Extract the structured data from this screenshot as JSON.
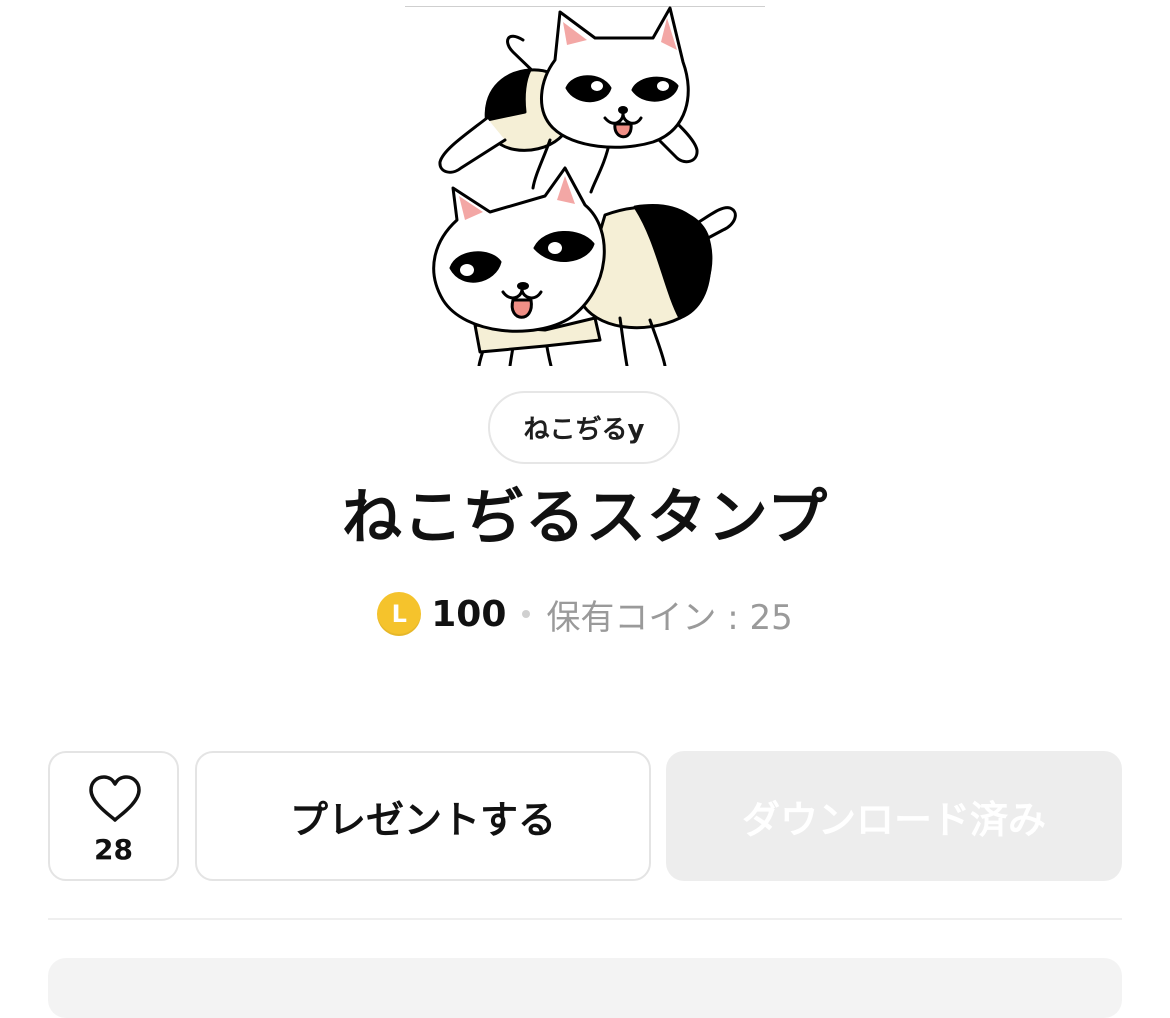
{
  "sticker": {
    "description_icon": "cat-sticker-image"
  },
  "author": {
    "name": "ねこぢるy"
  },
  "title": "ねこぢるスタンプ",
  "price": {
    "coin_icon": "line-coin-icon",
    "coin_letter": "L",
    "amount": "100",
    "owned_label": "保有コイン : 25"
  },
  "actions": {
    "like_icon": "heart-icon",
    "like_count": "28",
    "gift_label": "プレゼントする",
    "download_label": "ダウンロード済み"
  },
  "colors": {
    "coin": "#f5c32c",
    "disabled_button_bg": "#ededed",
    "muted_text": "#9a9a9a"
  }
}
